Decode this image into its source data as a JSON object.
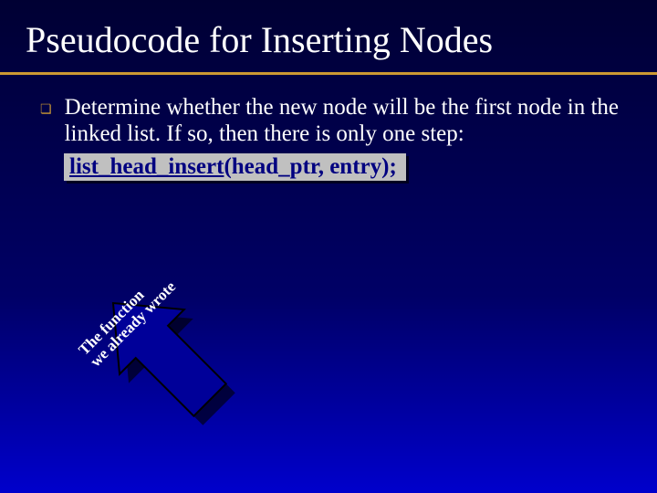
{
  "title": "Pseudocode for Inserting Nodes",
  "bullet_text": "Determine whether the new node will be the first node in the linked list.  If so, then there is only one step:",
  "code_fn": "list_head_insert",
  "code_args": "(head_ptr, entry);",
  "arrow_line1": "The function",
  "arrow_line2": "we already wrote",
  "colors": {
    "accent": "#cc9933",
    "code_bg": "#c0c0c0",
    "code_fg": "#000080"
  }
}
